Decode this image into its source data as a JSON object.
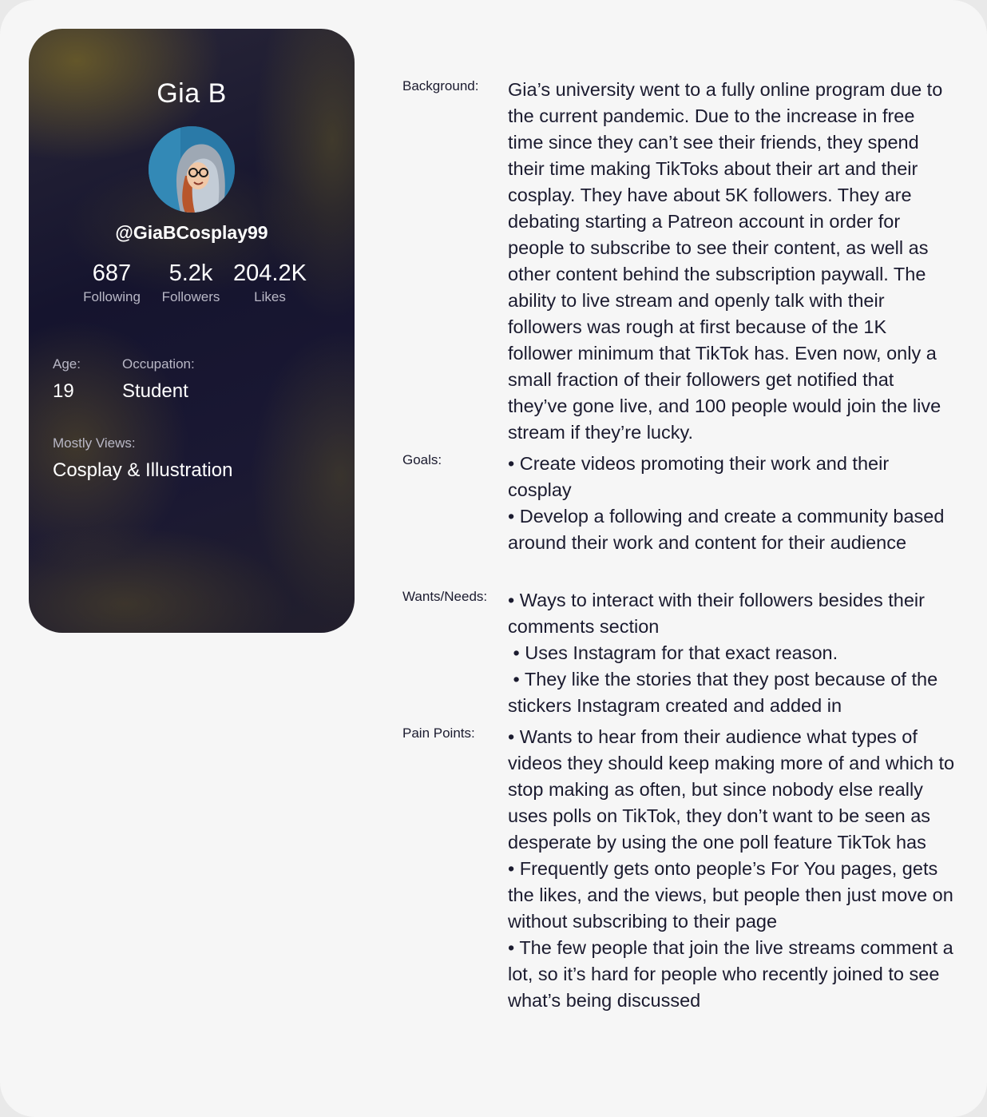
{
  "profile": {
    "name": "Gia B",
    "handle": "@GiaBCosplay99",
    "stats": [
      {
        "value": "687",
        "label": "Following"
      },
      {
        "value": "5.2k",
        "label": "Followers"
      },
      {
        "value": "204.2K",
        "label": "Likes"
      }
    ],
    "age_label": "Age:",
    "age": "19",
    "occupation_label": "Occupation:",
    "occupation": "Student",
    "views_label": "Mostly Views:",
    "views": "Cosplay & Illustration"
  },
  "details": {
    "background_label": "Background:",
    "background_text": "Gia’s university went to a fully online program due to the current pandemic. Due to the increase in free time since they can’t see their friends, they spend their time making TikToks about their art and their cosplay. They have about 5K followers. They are debating starting a Patreon account in order for people to subscribe to see their content, as well as other content behind the subscription paywall. The ability to live stream and openly talk with their followers was rough at first because of the 1K follower minimum that TikTok has. Even now, only a small fraction of their followers get notified that they’ve gone live, and 100 people would join the live stream if they’re lucky.",
    "goals_label": "Goals:",
    "goals": [
      "• Create videos promoting their work and their cosplay",
      "• Develop a following and create a community based around their work and content for their audience"
    ],
    "wants_label": "Wants/Needs:",
    "wants": [
      "• Ways to interact with their followers besides their comments section",
      " • Uses Instagram for that exact reason.",
      " • They like the stories that they post because of the stickers Instagram created and added in"
    ],
    "pain_label": "Pain Points:",
    "pain_points": [
      "• Wants to hear from their audience what types of videos they should keep making more of and which to stop making as often, but since nobody else really uses polls on TikTok, they don’t want to be seen as desperate by using the one poll feature TikTok has",
      "• Frequently gets onto people’s For You pages, gets the likes, and the views, but people then just move on without subscribing to their page",
      "• The few people that join the live streams comment a lot, so it’s hard for people who recently joined to see what’s being discussed"
    ]
  }
}
